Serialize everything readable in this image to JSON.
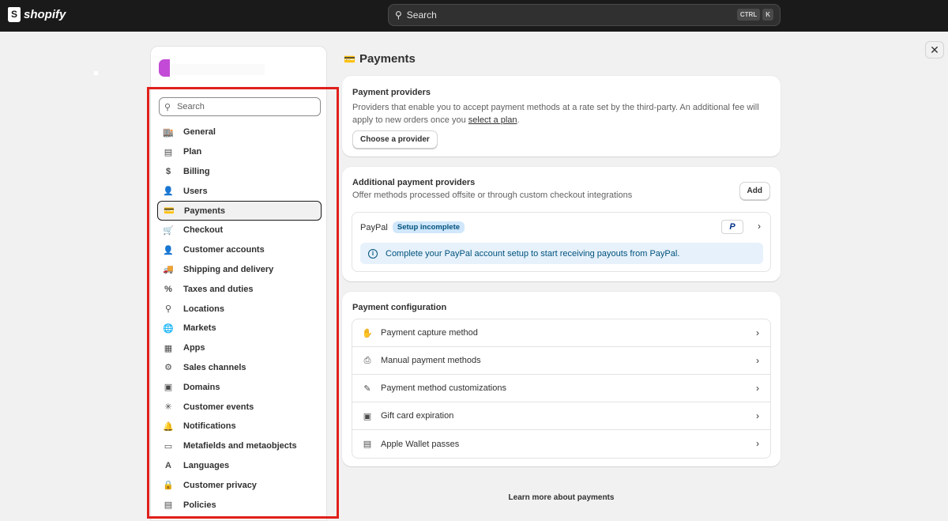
{
  "topbar": {
    "brand": "shopify",
    "search_label": "Search",
    "kbd": [
      "CTRL",
      "K"
    ]
  },
  "sidebar": {
    "search_placeholder": "Search",
    "items": [
      {
        "label": "General",
        "icon": "store-icon",
        "glyph": "🏬"
      },
      {
        "label": "Plan",
        "icon": "plan-icon",
        "glyph": "▤"
      },
      {
        "label": "Billing",
        "icon": "billing-icon",
        "glyph": "$"
      },
      {
        "label": "Users",
        "icon": "users-icon",
        "glyph": "👤"
      },
      {
        "label": "Payments",
        "icon": "payments-icon",
        "glyph": "💳",
        "active": true
      },
      {
        "label": "Checkout",
        "icon": "cart-icon",
        "glyph": "🛒"
      },
      {
        "label": "Customer accounts",
        "icon": "person-icon",
        "glyph": "👤"
      },
      {
        "label": "Shipping and delivery",
        "icon": "truck-icon",
        "glyph": "🚚"
      },
      {
        "label": "Taxes and duties",
        "icon": "tax-icon",
        "glyph": "%"
      },
      {
        "label": "Locations",
        "icon": "location-icon",
        "glyph": "⚲"
      },
      {
        "label": "Markets",
        "icon": "globe-icon",
        "glyph": "🌐"
      },
      {
        "label": "Apps",
        "icon": "apps-icon",
        "glyph": "▦"
      },
      {
        "label": "Sales channels",
        "icon": "sales-channels-icon",
        "glyph": "⚙"
      },
      {
        "label": "Domains",
        "icon": "domains-icon",
        "glyph": "▣"
      },
      {
        "label": "Customer events",
        "icon": "cursor-icon",
        "glyph": "✳"
      },
      {
        "label": "Notifications",
        "icon": "bell-icon",
        "glyph": "🔔"
      },
      {
        "label": "Metafields and metaobjects",
        "icon": "metafields-icon",
        "glyph": "▭"
      },
      {
        "label": "Languages",
        "icon": "language-icon",
        "glyph": "A"
      },
      {
        "label": "Customer privacy",
        "icon": "lock-icon",
        "glyph": "🔒"
      },
      {
        "label": "Policies",
        "icon": "policies-icon",
        "glyph": "▤"
      }
    ]
  },
  "main": {
    "title": "Payments",
    "providers": {
      "title": "Payment providers",
      "text_before": "Providers that enable you to accept payment methods at a rate set by the third-party. An additional fee will apply to new orders once you ",
      "link": "select a plan",
      "text_after": ".",
      "button": "Choose a provider"
    },
    "additional": {
      "title": "Additional payment providers",
      "subtitle": "Offer methods processed offsite or through custom checkout integrations",
      "add_button": "Add",
      "provider_name": "PayPal",
      "badge": "Setup incomplete",
      "logo_text": "P",
      "banner": "Complete your PayPal account setup to start receiving payouts from PayPal."
    },
    "config": {
      "title": "Payment configuration",
      "rows": [
        {
          "label": "Payment capture method",
          "icon": "capture-icon",
          "glyph": "✋"
        },
        {
          "label": "Manual payment methods",
          "icon": "manual-payment-icon",
          "glyph": "⎙"
        },
        {
          "label": "Payment method customizations",
          "icon": "customize-icon",
          "glyph": "✎"
        },
        {
          "label": "Gift card expiration",
          "icon": "gift-card-icon",
          "glyph": "▣"
        },
        {
          "label": "Apple Wallet passes",
          "icon": "wallet-icon",
          "glyph": "▤"
        }
      ]
    },
    "learn_more": "Learn more about payments"
  }
}
